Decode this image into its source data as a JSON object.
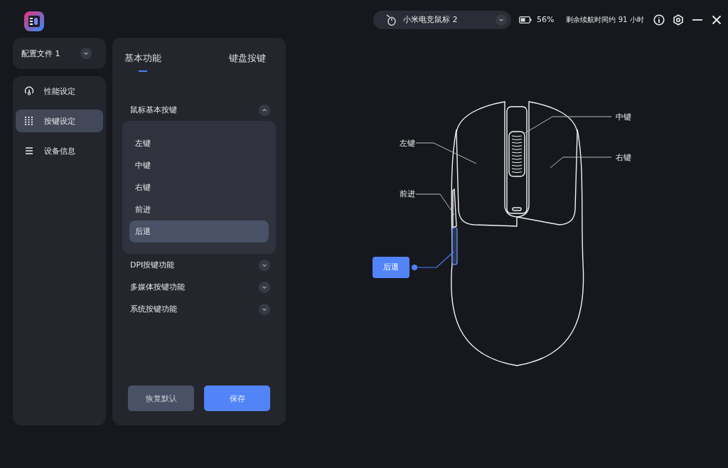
{
  "header": {
    "device": "小米电竞鼠标 2",
    "battery": "56%",
    "runtime": "剩余续航时间约 91 小时"
  },
  "profile": {
    "label": "配置文件 1"
  },
  "nav": [
    {
      "label": "性能设定",
      "selected": false
    },
    {
      "label": "按键设定",
      "selected": true
    },
    {
      "label": "设备信息",
      "selected": false
    }
  ],
  "tabs": [
    {
      "label": "基本功能",
      "selected": true
    },
    {
      "label": "键盘按键",
      "selected": false
    }
  ],
  "sections": [
    {
      "title": "鼠标基本按键",
      "expanded": true,
      "items": [
        {
          "label": "左键",
          "selected": false
        },
        {
          "label": "中键",
          "selected": false
        },
        {
          "label": "右键",
          "selected": false
        },
        {
          "label": "前进",
          "selected": false
        },
        {
          "label": "后退",
          "selected": true
        }
      ]
    },
    {
      "title": "DPI按键功能",
      "expanded": false
    },
    {
      "title": "多媒体按键功能",
      "expanded": false
    },
    {
      "title": "系统按键功能",
      "expanded": false
    }
  ],
  "buttons": [
    {
      "label": "恢复默认",
      "kind": "secondary"
    },
    {
      "label": "保存",
      "kind": "primary"
    }
  ],
  "diagram": [
    {
      "label": "左键",
      "selected": false
    },
    {
      "label": "中键",
      "selected": false
    },
    {
      "label": "右键",
      "selected": false
    },
    {
      "label": "前进",
      "selected": false
    },
    {
      "label": "后退",
      "selected": true
    }
  ]
}
